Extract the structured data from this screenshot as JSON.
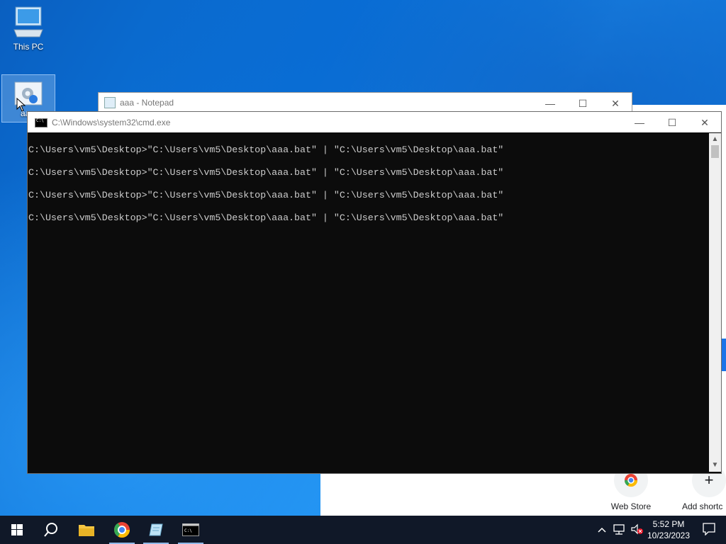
{
  "desktop": {
    "icons": [
      {
        "label": "This PC"
      },
      {
        "label": "aa"
      }
    ]
  },
  "chrome": {
    "shortcuts": [
      {
        "label": "Web Store"
      },
      {
        "label": "Add shortc"
      }
    ]
  },
  "notepad": {
    "title": "aaa - Notepad"
  },
  "cmd": {
    "title": "C:\\Windows\\system32\\cmd.exe",
    "lines": [
      "C:\\Users\\vm5\\Desktop>\"C:\\Users\\vm5\\Desktop\\aaa.bat\" | \"C:\\Users\\vm5\\Desktop\\aaa.bat\"",
      "C:\\Users\\vm5\\Desktop>\"C:\\Users\\vm5\\Desktop\\aaa.bat\" | \"C:\\Users\\vm5\\Desktop\\aaa.bat\"",
      "C:\\Users\\vm5\\Desktop>\"C:\\Users\\vm5\\Desktop\\aaa.bat\" | \"C:\\Users\\vm5\\Desktop\\aaa.bat\"",
      "C:\\Users\\vm5\\Desktop>\"C:\\Users\\vm5\\Desktop\\aaa.bat\" | \"C:\\Users\\vm5\\Desktop\\aaa.bat\""
    ]
  },
  "window_controls": {
    "minimize": "—",
    "maximize": "☐",
    "close": "✕"
  },
  "taskbar": {
    "apps": [
      "start",
      "search",
      "file-explorer",
      "chrome",
      "notepad",
      "cmd"
    ],
    "clock": {
      "time": "5:52 PM",
      "date": "10/23/2023"
    }
  },
  "colors": {
    "console_bg": "#0c0c0c",
    "console_fg": "#cccccc",
    "taskbar_bg": "#101828"
  }
}
